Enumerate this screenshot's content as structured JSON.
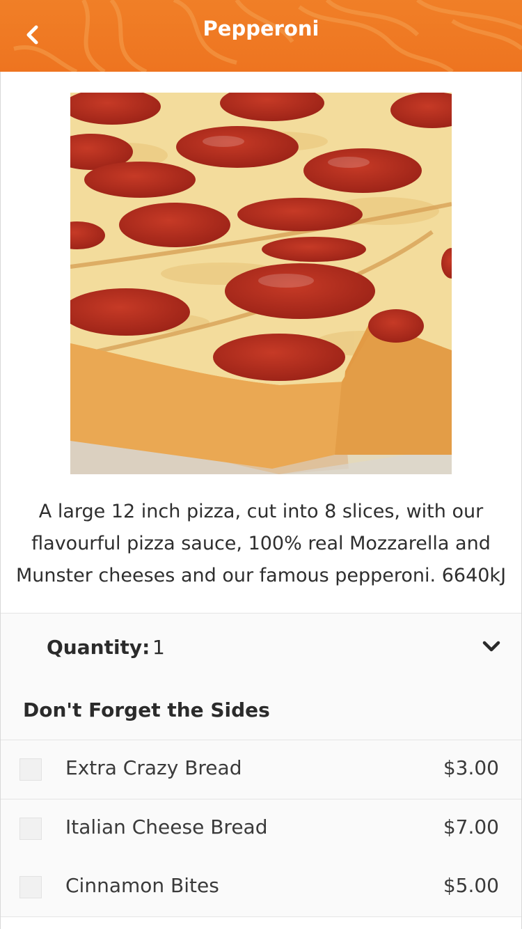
{
  "header": {
    "title": "Pepperoni",
    "back_icon": "chevron-left-icon",
    "color": "#ef7a22"
  },
  "product": {
    "image_alt": "pepperoni-pizza-photo",
    "description": "A large 12 inch pizza, cut into 8 slices, with our flavourful pizza sauce, 100% real Mozzarella and Munster cheeses and our famous pepperoni. 6640kJ"
  },
  "quantity": {
    "label": "Quantity:",
    "value": "1",
    "icon": "chevron-down-icon"
  },
  "sides": {
    "heading": "Don't Forget the Sides",
    "items": [
      {
        "name": "Extra Crazy Bread",
        "price": "$3.00",
        "checked": false
      },
      {
        "name": "Italian Cheese Bread",
        "price": "$7.00",
        "checked": false
      },
      {
        "name": "Cinnamon Bites",
        "price": "$5.00",
        "checked": false
      }
    ]
  }
}
